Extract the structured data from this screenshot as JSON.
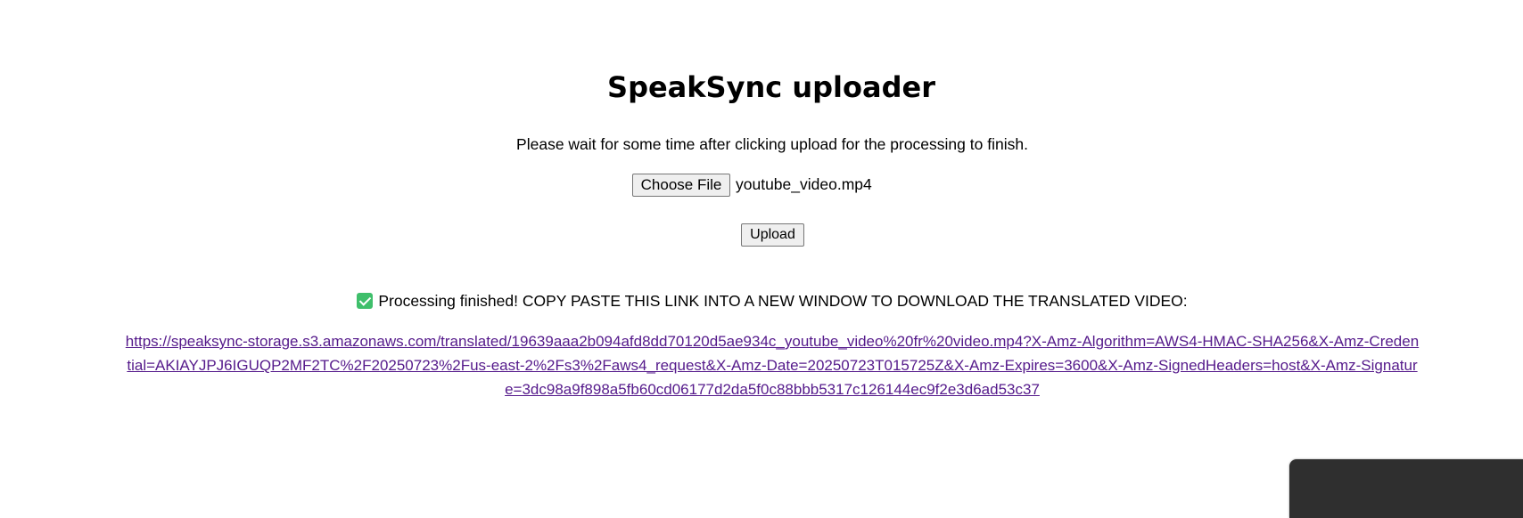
{
  "header": {
    "title": "SpeakSync uploader",
    "subtitle": "Please wait for some time after clicking upload for the processing to finish."
  },
  "file_input": {
    "button_label": "Choose File",
    "selected_file": "youtube_video.mp4"
  },
  "upload": {
    "button_label": "Upload"
  },
  "result": {
    "status_icon": "check-icon",
    "status_text": "Processing finished! COPY PASTE THIS LINK INTO A NEW WINDOW TO DOWNLOAD THE TRANSLATED VIDEO:",
    "link_text": "https://speaksync-storage.s3.amazonaws.com/translated/19639aaa2b094afd8dd70120d5ae934c_youtube_video%20fr%20video.mp4?X-Amz-Algorithm=AWS4-HMAC-SHA256&X-Amz-Credential=AKIAYJPJ6IGUQP2MF2TC%2F20250723%2Fus-east-2%2Fs3%2Faws4_request&X-Amz-Date=20250723T015725Z&X-Amz-Expires=3600&X-Amz-SignedHeaders=host&X-Amz-Signature=3dc98a9f898a5fb60cd06177d2da5f0c88bbb5317c126144ec9f2e3d6ad53c37"
  },
  "colors": {
    "link_visited": "#551a8b",
    "check_green": "#3fbf6b",
    "panel_dark": "#2f2f2f"
  }
}
